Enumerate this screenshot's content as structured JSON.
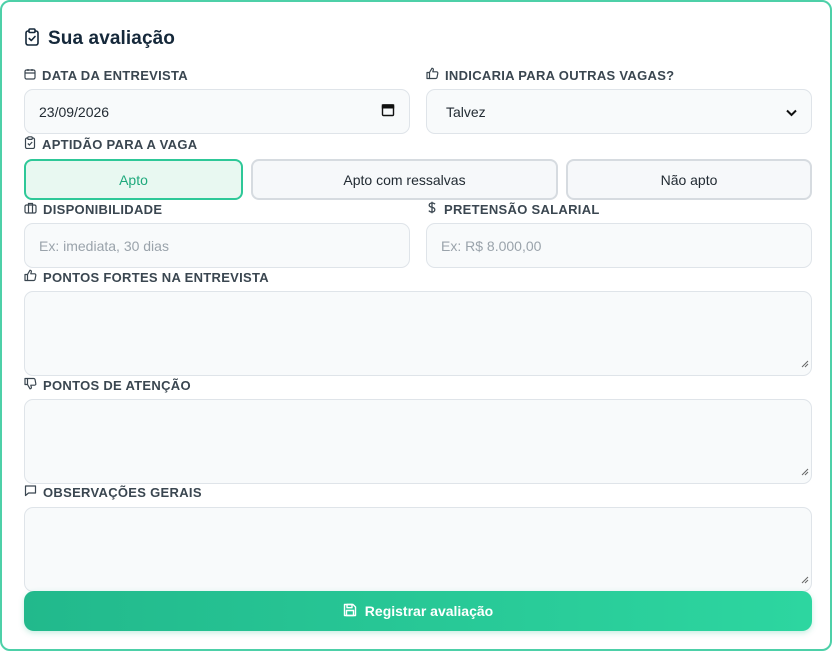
{
  "form": {
    "title": "Sua avaliação",
    "title_icon": "clipboard-check-icon",
    "accent_color": "#2ec898"
  },
  "fields": {
    "interview_date": {
      "label": "DATA DA ENTREVISTA",
      "icon": "calendar-icon",
      "value": "23/09/2026"
    },
    "recommend": {
      "label": "INDICARIA PARA OUTRAS VAGAS?",
      "icon": "thumbs-up-icon",
      "value": "Talvez"
    },
    "fitness": {
      "label": "APTIDÃO PARA A VAGA",
      "icon": "clipboard-check-icon",
      "options": [
        "Apto",
        "Apto com ressalvas",
        "Não apto"
      ],
      "selected": "Apto"
    },
    "availability": {
      "label": "DISPONIBILIDADE",
      "icon": "briefcase-icon",
      "placeholder": "Ex: imediata, 30 dias"
    },
    "salary": {
      "label": "PRETENSÃO SALARIAL",
      "icon": "dollar-icon",
      "placeholder": "Ex: R$ 8.000,00"
    },
    "strengths": {
      "label": "PONTOS FORTES NA ENTREVISTA",
      "icon": "thumbs-up-icon"
    },
    "concerns": {
      "label": "PONTOS DE ATENÇÃO",
      "icon": "thumbs-down-icon"
    },
    "notes": {
      "label": "OBSERVAÇÕES GERAIS",
      "icon": "message-icon"
    }
  },
  "actions": {
    "submit_label": "Registrar avaliação",
    "submit_icon": "save-icon"
  }
}
